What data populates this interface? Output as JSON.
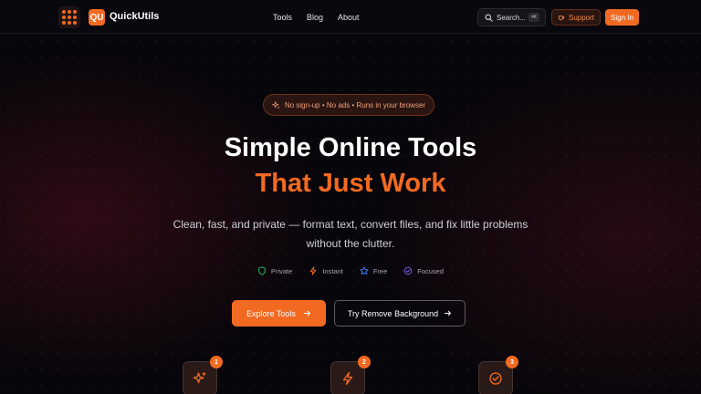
{
  "nav": {
    "brand_logo": "QU",
    "brand_name": "QuickUtils",
    "links": [
      "Tools",
      "Blog",
      "About"
    ],
    "search_placeholder": "Search...",
    "search_shortcut": "⌘K",
    "support_label": "Support",
    "signin_label": "Sign In"
  },
  "hero": {
    "badge": "No sign-up • No ads • Runs in your browser",
    "title_line1": "Simple Online Tools",
    "title_line2": "That Just Work",
    "subtitle": "Clean, fast, and private — format text, convert files, and fix little problems without the clutter.",
    "features": [
      {
        "label": "Private",
        "icon": "shield-icon",
        "color": "#22c55e"
      },
      {
        "label": "Instant",
        "icon": "bolt-icon",
        "color": "#f26a21"
      },
      {
        "label": "Free",
        "icon": "star-icon",
        "color": "#3b82f6"
      },
      {
        "label": "Focused",
        "icon": "check-circle-icon",
        "color": "#8b5cf6"
      }
    ],
    "primary_cta": "Explore Tools",
    "secondary_cta": "Try Remove Background"
  },
  "steps": [
    {
      "number": "1",
      "icon": "sparkles-icon"
    },
    {
      "number": "2",
      "icon": "bolt-icon"
    },
    {
      "number": "3",
      "icon": "check-circle-icon"
    }
  ],
  "colors": {
    "accent": "#f26a21",
    "background": "#07060a"
  }
}
